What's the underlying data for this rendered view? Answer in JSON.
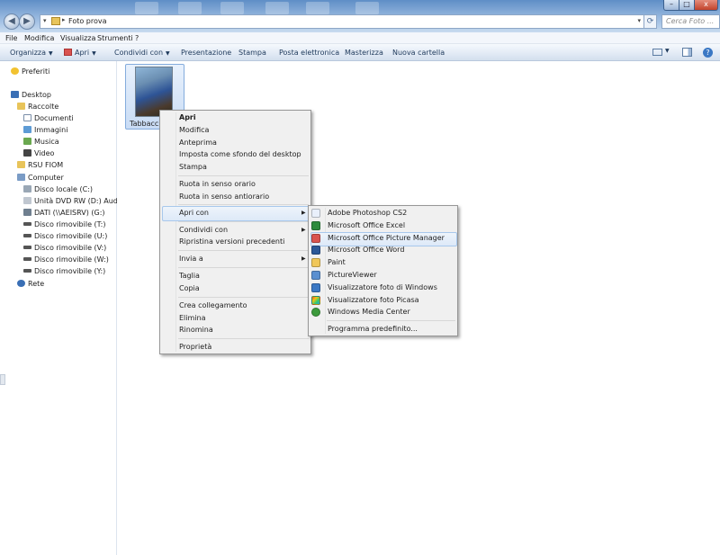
{
  "window": {
    "breadcrumb": "Foto prova",
    "search_placeholder": "Cerca Foto ...",
    "buttons": {
      "minimize": "–",
      "maximize": "□",
      "close": "x"
    }
  },
  "menubar": [
    "File",
    "Modifica",
    "Visualizza",
    "Strumenti",
    "?"
  ],
  "commandbar": [
    "Organizza",
    "Apri",
    "Condividi con",
    "Presentazione",
    "Stampa",
    "Posta elettronica",
    "Masterizza",
    "Nuova cartella"
  ],
  "nav": {
    "favorites": "Preferiti",
    "desktop": "Desktop",
    "libraries": "Raccolte",
    "library_items": [
      "Documenti",
      "Immagini",
      "Musica",
      "Video"
    ],
    "user": "RSU FIOM",
    "computer": "Computer",
    "drives": [
      "Disco locale (C:)",
      "Unità DVD RW (D:) Audio CD",
      "DATI (\\\\AEISRV) (G:)",
      "Disco rimovibile (T:)",
      "Disco rimovibile (U:)",
      "Disco rimovibile (V:)",
      "Disco rimovibile (W:)",
      "Disco rimovibile (Y:)"
    ],
    "network": "Rete"
  },
  "file": {
    "name": "Tabbacchi"
  },
  "context_menu": {
    "open": "Apri",
    "items_a": [
      "Modifica",
      "Anteprima",
      "Imposta come sfondo del desktop",
      "Stampa"
    ],
    "items_b": [
      "Ruota in senso orario",
      "Ruota in senso antiorario"
    ],
    "open_with": "Apri con",
    "share_with": "Condividi con",
    "restore": "Ripristina versioni precedenti",
    "send_to": "Invia a",
    "items_c": [
      "Taglia",
      "Copia"
    ],
    "items_d": [
      "Crea collegamento",
      "Elimina",
      "Rinomina"
    ],
    "properties": "Proprietà"
  },
  "submenu": {
    "apps": [
      "Adobe Photoshop CS2",
      "Microsoft Office Excel",
      "Microsoft Office Picture Manager",
      "Microsoft Office Word",
      "Paint",
      "PictureViewer",
      "Visualizzatore foto di Windows",
      "Visualizzatore foto Picasa",
      "Windows Media Center"
    ],
    "default_program": "Programma predefinito..."
  }
}
